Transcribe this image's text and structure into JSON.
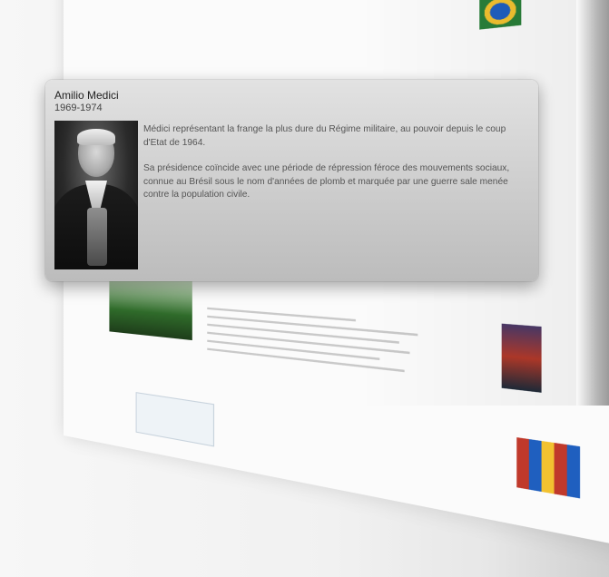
{
  "popup": {
    "name": "Amilio Medici",
    "years": "1969-1974",
    "portrait_alt": "portrait",
    "paragraphs": [
      "Médici représentant la frange la plus dure du Régime militaire, au pouvoir depuis le coup d'Etat de 1964.",
      "Sa présidence coïncide avec une période de répression féroce des mouvements sociaux, connue au Brésil sous le nom d'années de plomb et marquée par une guerre sale menée contre la population civile."
    ]
  },
  "background": {
    "thumbnail_colors": [
      "#2f6b2a",
      "#2a7f3a",
      "#1f5fbf",
      "#f2c230",
      "#b33a2a",
      "#3b5998"
    ]
  }
}
